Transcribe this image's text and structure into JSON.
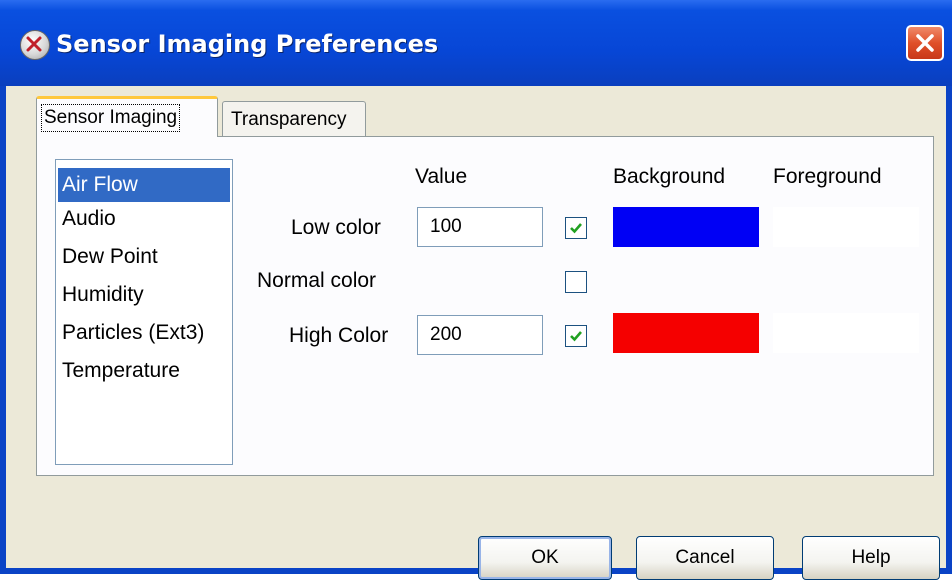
{
  "window": {
    "title": "Sensor Imaging Preferences",
    "app_icon": "sensor-app-icon",
    "close_icon": "close-icon"
  },
  "tabs": [
    {
      "label": "Sensor Imaging",
      "active": true
    },
    {
      "label": "Transparency",
      "active": false
    }
  ],
  "sensors": {
    "items": [
      "Air Flow",
      "Audio",
      "Dew Point",
      "Humidity",
      "Particles (Ext3)",
      "Temperature"
    ],
    "selected": "Air Flow"
  },
  "columns": {
    "value": "Value",
    "background": "Background",
    "foreground": "Foreground"
  },
  "rows": {
    "low": {
      "label": "Low color",
      "value": "100",
      "checked": true,
      "background": "#0000f5",
      "foreground": "#ffffff"
    },
    "normal": {
      "label": "Normal color",
      "checked": false
    },
    "high": {
      "label": "High Color",
      "value": "200",
      "checked": true,
      "background": "#f50000",
      "foreground": "#ffffff"
    }
  },
  "buttons": {
    "ok": "OK",
    "cancel": "Cancel",
    "help": "Help"
  },
  "colors": {
    "title_bar": "#0746d6",
    "selection": "#316ac5",
    "active_tab_accent": "#ffc83c",
    "check_mark": "#21a121"
  }
}
